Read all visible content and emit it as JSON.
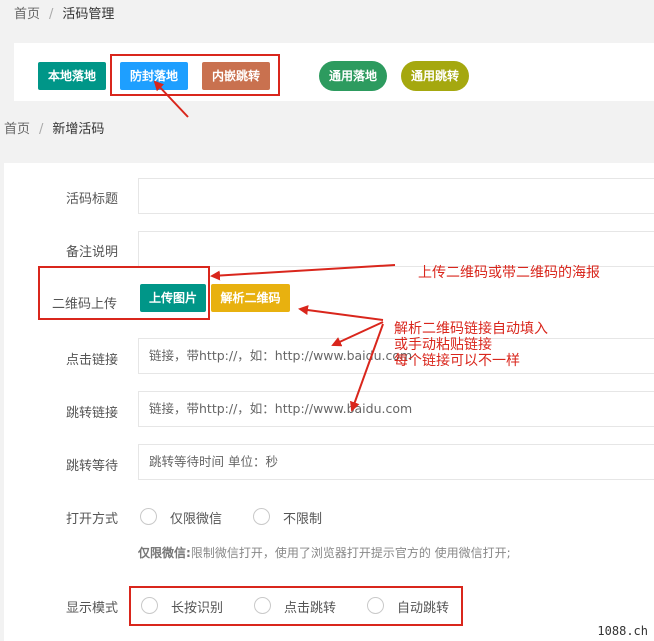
{
  "breadcrumb_top": {
    "home": "首页",
    "current": "活码管理"
  },
  "mode_buttons": [
    {
      "label": "本地落地",
      "color": "#009688"
    },
    {
      "label": "防封落地",
      "color": "#1E9FFF"
    },
    {
      "label": "内嵌跳转",
      "color": "#C9714F"
    },
    {
      "label": "通用落地",
      "color": "#2D9B5F"
    },
    {
      "label": "通用跳转",
      "color": "#A5A80F"
    }
  ],
  "breadcrumb_2": {
    "home": "首页",
    "current": "新增活码"
  },
  "form": {
    "title_label": "活码标题",
    "remark_label": "备注说明",
    "qr_label": "二维码上传",
    "upload_button": "上传图片",
    "parse_button": "解析二维码",
    "click_link_label": "点击链接",
    "click_link_placeholder": "链接，带http://，如：http://www.baidu.com",
    "jump_link_label": "跳转链接",
    "jump_link_placeholder": "链接，带http://，如：http://www.baidu.com",
    "wait_label": "跳转等待",
    "wait_placeholder": "跳转等待时间 单位：秒",
    "open_label": "打开方式",
    "open_options": [
      "仅限微信",
      "不限制"
    ],
    "open_hint_title": "仅限微信:",
    "open_hint_text": "限制微信打开，使用了浏览器打开提示官方的 使用微信打开;",
    "display_label": "显示模式",
    "display_options": [
      "长按识别",
      "点击跳转",
      "自动跳转"
    ]
  },
  "annotations": {
    "upload_note": "上传二维码或带二维码的海报",
    "parse_note_1": "解析二维码链接自动填入",
    "parse_note_2": "或手动粘贴链接",
    "parse_note_3": "每个链接可以不一样"
  },
  "watermark": "1088.ch",
  "colors": {
    "annotation_red": "#D9261C",
    "upload_teal": "#009688",
    "parse_yellow": "#E8B10F"
  }
}
